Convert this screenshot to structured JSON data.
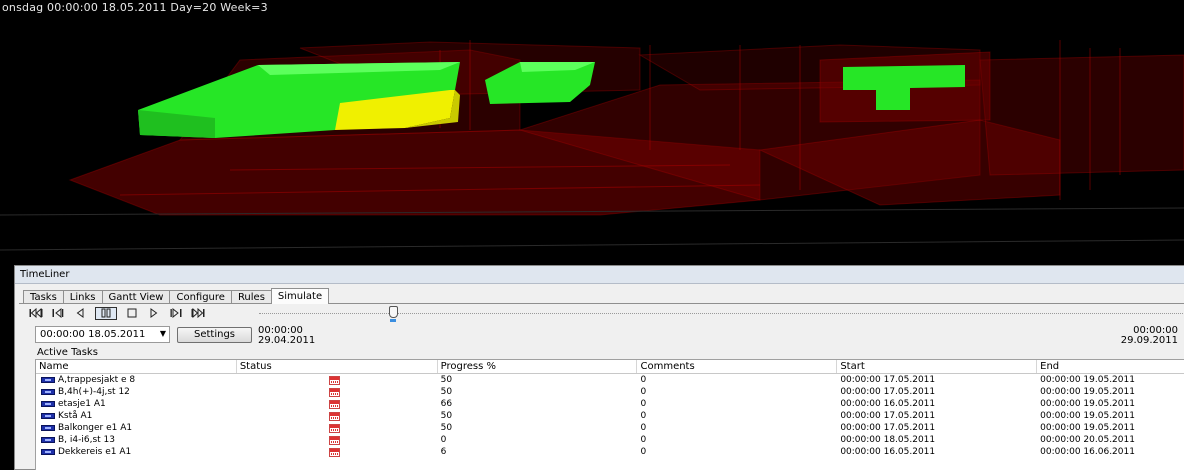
{
  "viewport": {
    "status_text": "onsdag 00:00:00 18.05.2011 Day=20 Week=3",
    "colors": {
      "background": "#000000",
      "planned": "#8b0000",
      "active": "#22ff22",
      "highlight": "#ffff00"
    }
  },
  "timeliner": {
    "title": "TimeLiner",
    "tabs": [
      "Tasks",
      "Links",
      "Gantt View",
      "Configure",
      "Rules",
      "Simulate"
    ],
    "active_tab": "Simulate",
    "transport": [
      "rewind-to-start",
      "step-back",
      "play-backward",
      "pause",
      "stop",
      "play-forward",
      "step-forward",
      "forward-to-end"
    ],
    "slider": {
      "position_fraction": 0.14
    },
    "current_date": "00:00:00 18.05.2011",
    "settings_label": "Settings",
    "range_start": {
      "time": "00:00:00",
      "date": "29.04.2011"
    },
    "range_end": {
      "time": "00:00:00",
      "date": "29.09.2011"
    },
    "active_tasks_label": "Active Tasks",
    "columns": [
      "Name",
      "Status",
      "Progress %",
      "Comments",
      "Start",
      "End"
    ],
    "tasks": [
      {
        "name": "A,trappesjakt e 8",
        "progress": "50",
        "comments": "0",
        "start": "00:00:00 17.05.2011",
        "end": "00:00:00 19.05.2011"
      },
      {
        "name": "B,4h(+)-4j,st 12",
        "progress": "50",
        "comments": "0",
        "start": "00:00:00 17.05.2011",
        "end": "00:00:00 19.05.2011"
      },
      {
        "name": "etasje1 A1",
        "progress": "66",
        "comments": "0",
        "start": "00:00:00 16.05.2011",
        "end": "00:00:00 19.05.2011"
      },
      {
        "name": "Kstå A1",
        "progress": "50",
        "comments": "0",
        "start": "00:00:00 17.05.2011",
        "end": "00:00:00 19.05.2011"
      },
      {
        "name": "Balkonger e1 A1",
        "progress": "50",
        "comments": "0",
        "start": "00:00:00 17.05.2011",
        "end": "00:00:00 19.05.2011"
      },
      {
        "name": "B, i4-i6,st 13",
        "progress": "0",
        "comments": "0",
        "start": "00:00:00 18.05.2011",
        "end": "00:00:00 20.05.2011"
      },
      {
        "name": "Dekkereis e1 A1",
        "progress": "6",
        "comments": "0",
        "start": "00:00:00 16.05.2011",
        "end": "00:00:00 16.06.2011"
      }
    ]
  }
}
